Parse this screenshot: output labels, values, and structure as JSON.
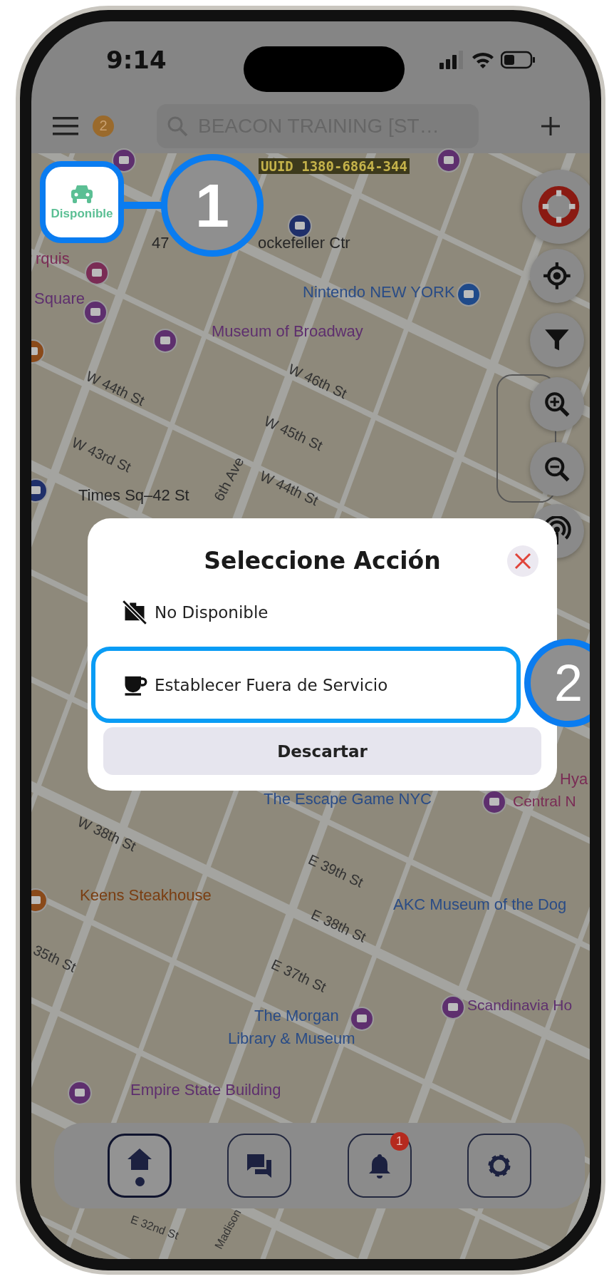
{
  "status_bar": {
    "time": "9:14"
  },
  "top_bar": {
    "notification_count": "2",
    "search": {
      "value": "BEACON TRAINING [ST…"
    }
  },
  "status_button": {
    "label": "Disponible"
  },
  "map": {
    "uuid": "UUID 1380-6864-344",
    "labels": [
      {
        "text": "ockefeller Ctr",
        "kind": "place"
      },
      {
        "text": "47",
        "kind": "place"
      },
      {
        "text": "Nintendo NEW YORK",
        "kind": "venue"
      },
      {
        "text": "Museum of Broadway",
        "kind": "attraction"
      },
      {
        "text": "Square",
        "kind": "attraction"
      },
      {
        "text": "rquis",
        "kind": "hotel"
      },
      {
        "text": "Times Sq–42 St",
        "kind": "place"
      },
      {
        "text": "W 44th St",
        "kind": "street"
      },
      {
        "text": "W 43rd St",
        "kind": "street"
      },
      {
        "text": "W 46th St",
        "kind": "street"
      },
      {
        "text": "W 45th St",
        "kind": "street"
      },
      {
        "text": "W 44th St",
        "kind": "street"
      },
      {
        "text": "6th Ave",
        "kind": "street"
      },
      {
        "text": "The Escape Game NYC",
        "kind": "venue"
      },
      {
        "text": "Hya",
        "kind": "hotel"
      },
      {
        "text": "Central N",
        "kind": "hotel"
      },
      {
        "text": "W 38th St",
        "kind": "street"
      },
      {
        "text": "E 39th St",
        "kind": "street"
      },
      {
        "text": "Keens Steakhouse",
        "kind": "restaurant"
      },
      {
        "text": "E 38th St",
        "kind": "street"
      },
      {
        "text": "AKC Museum of the Dog",
        "kind": "venue"
      },
      {
        "text": "35th St",
        "kind": "street"
      },
      {
        "text": "E 37th St",
        "kind": "street"
      },
      {
        "text": "Scandinavia Ho",
        "kind": "attraction"
      },
      {
        "text": "The Morgan",
        "kind": "venue"
      },
      {
        "text": "Library & Museum",
        "kind": "venue"
      },
      {
        "text": "Empire State Building",
        "kind": "attraction"
      },
      {
        "text": "E 32nd St",
        "kind": "street"
      },
      {
        "text": "Madison",
        "kind": "street"
      }
    ]
  },
  "dialog": {
    "title": "Seleccione Acción",
    "options": [
      {
        "label": "No Disponible",
        "kind": "unavailable",
        "highlighted": false
      },
      {
        "label": "Establecer Fuera de Servicio",
        "kind": "out_of_service",
        "highlighted": true
      }
    ],
    "dismiss": "Descartar"
  },
  "callouts": [
    {
      "number": "1"
    },
    {
      "number": "2"
    }
  ],
  "bottom_nav": [
    {
      "kind": "home",
      "selected": true
    },
    {
      "kind": "chat",
      "selected": false
    },
    {
      "kind": "notifications",
      "selected": false,
      "badge": "1"
    },
    {
      "kind": "settings",
      "selected": false
    }
  ]
}
